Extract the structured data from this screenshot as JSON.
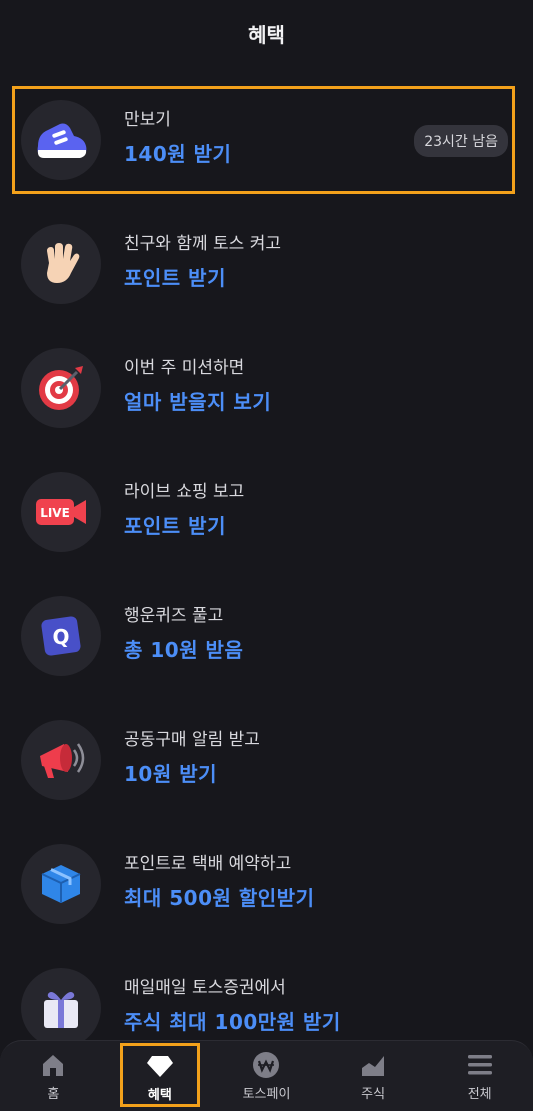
{
  "header": {
    "title": "혜택"
  },
  "benefits": [
    {
      "sub": "만보기",
      "main": "140원 받기",
      "badge": "23시간 남음",
      "icon": "sneaker-icon"
    },
    {
      "sub": "친구와 함께 토스 켜고",
      "main": "포인트 받기",
      "icon": "waving-hand-icon"
    },
    {
      "sub": "이번 주 미션하면",
      "main": "얼마 받을지 보기",
      "icon": "target-dart-icon"
    },
    {
      "sub": "라이브 쇼핑 보고",
      "main": "포인트 받기",
      "icon": "live-camera-icon",
      "icon_text": "LIVE"
    },
    {
      "sub": "행운퀴즈 풀고",
      "main": "총 10원 받음",
      "icon": "quiz-q-icon",
      "icon_text": "Q"
    },
    {
      "sub": "공동구매 알림 받고",
      "main": "10원 받기",
      "icon": "megaphone-icon"
    },
    {
      "sub": "포인트로 택배 예약하고",
      "main": "최대 500원 할인받기",
      "icon": "parcel-box-icon"
    },
    {
      "sub": "매일매일 토스증권에서",
      "main": "주식 최대 100만원 받기",
      "icon": "gift-box-icon"
    }
  ],
  "tabs": [
    {
      "label": "홈",
      "icon": "home-icon"
    },
    {
      "label": "혜택",
      "icon": "diamond-icon"
    },
    {
      "label": "토스페이",
      "icon": "won-coin-icon"
    },
    {
      "label": "주식",
      "icon": "chart-icon"
    },
    {
      "label": "전체",
      "icon": "menu-icon"
    }
  ],
  "colors": {
    "background": "#17171c",
    "accent_blue": "#4c8ef7",
    "highlight_orange": "#f3a11b"
  }
}
